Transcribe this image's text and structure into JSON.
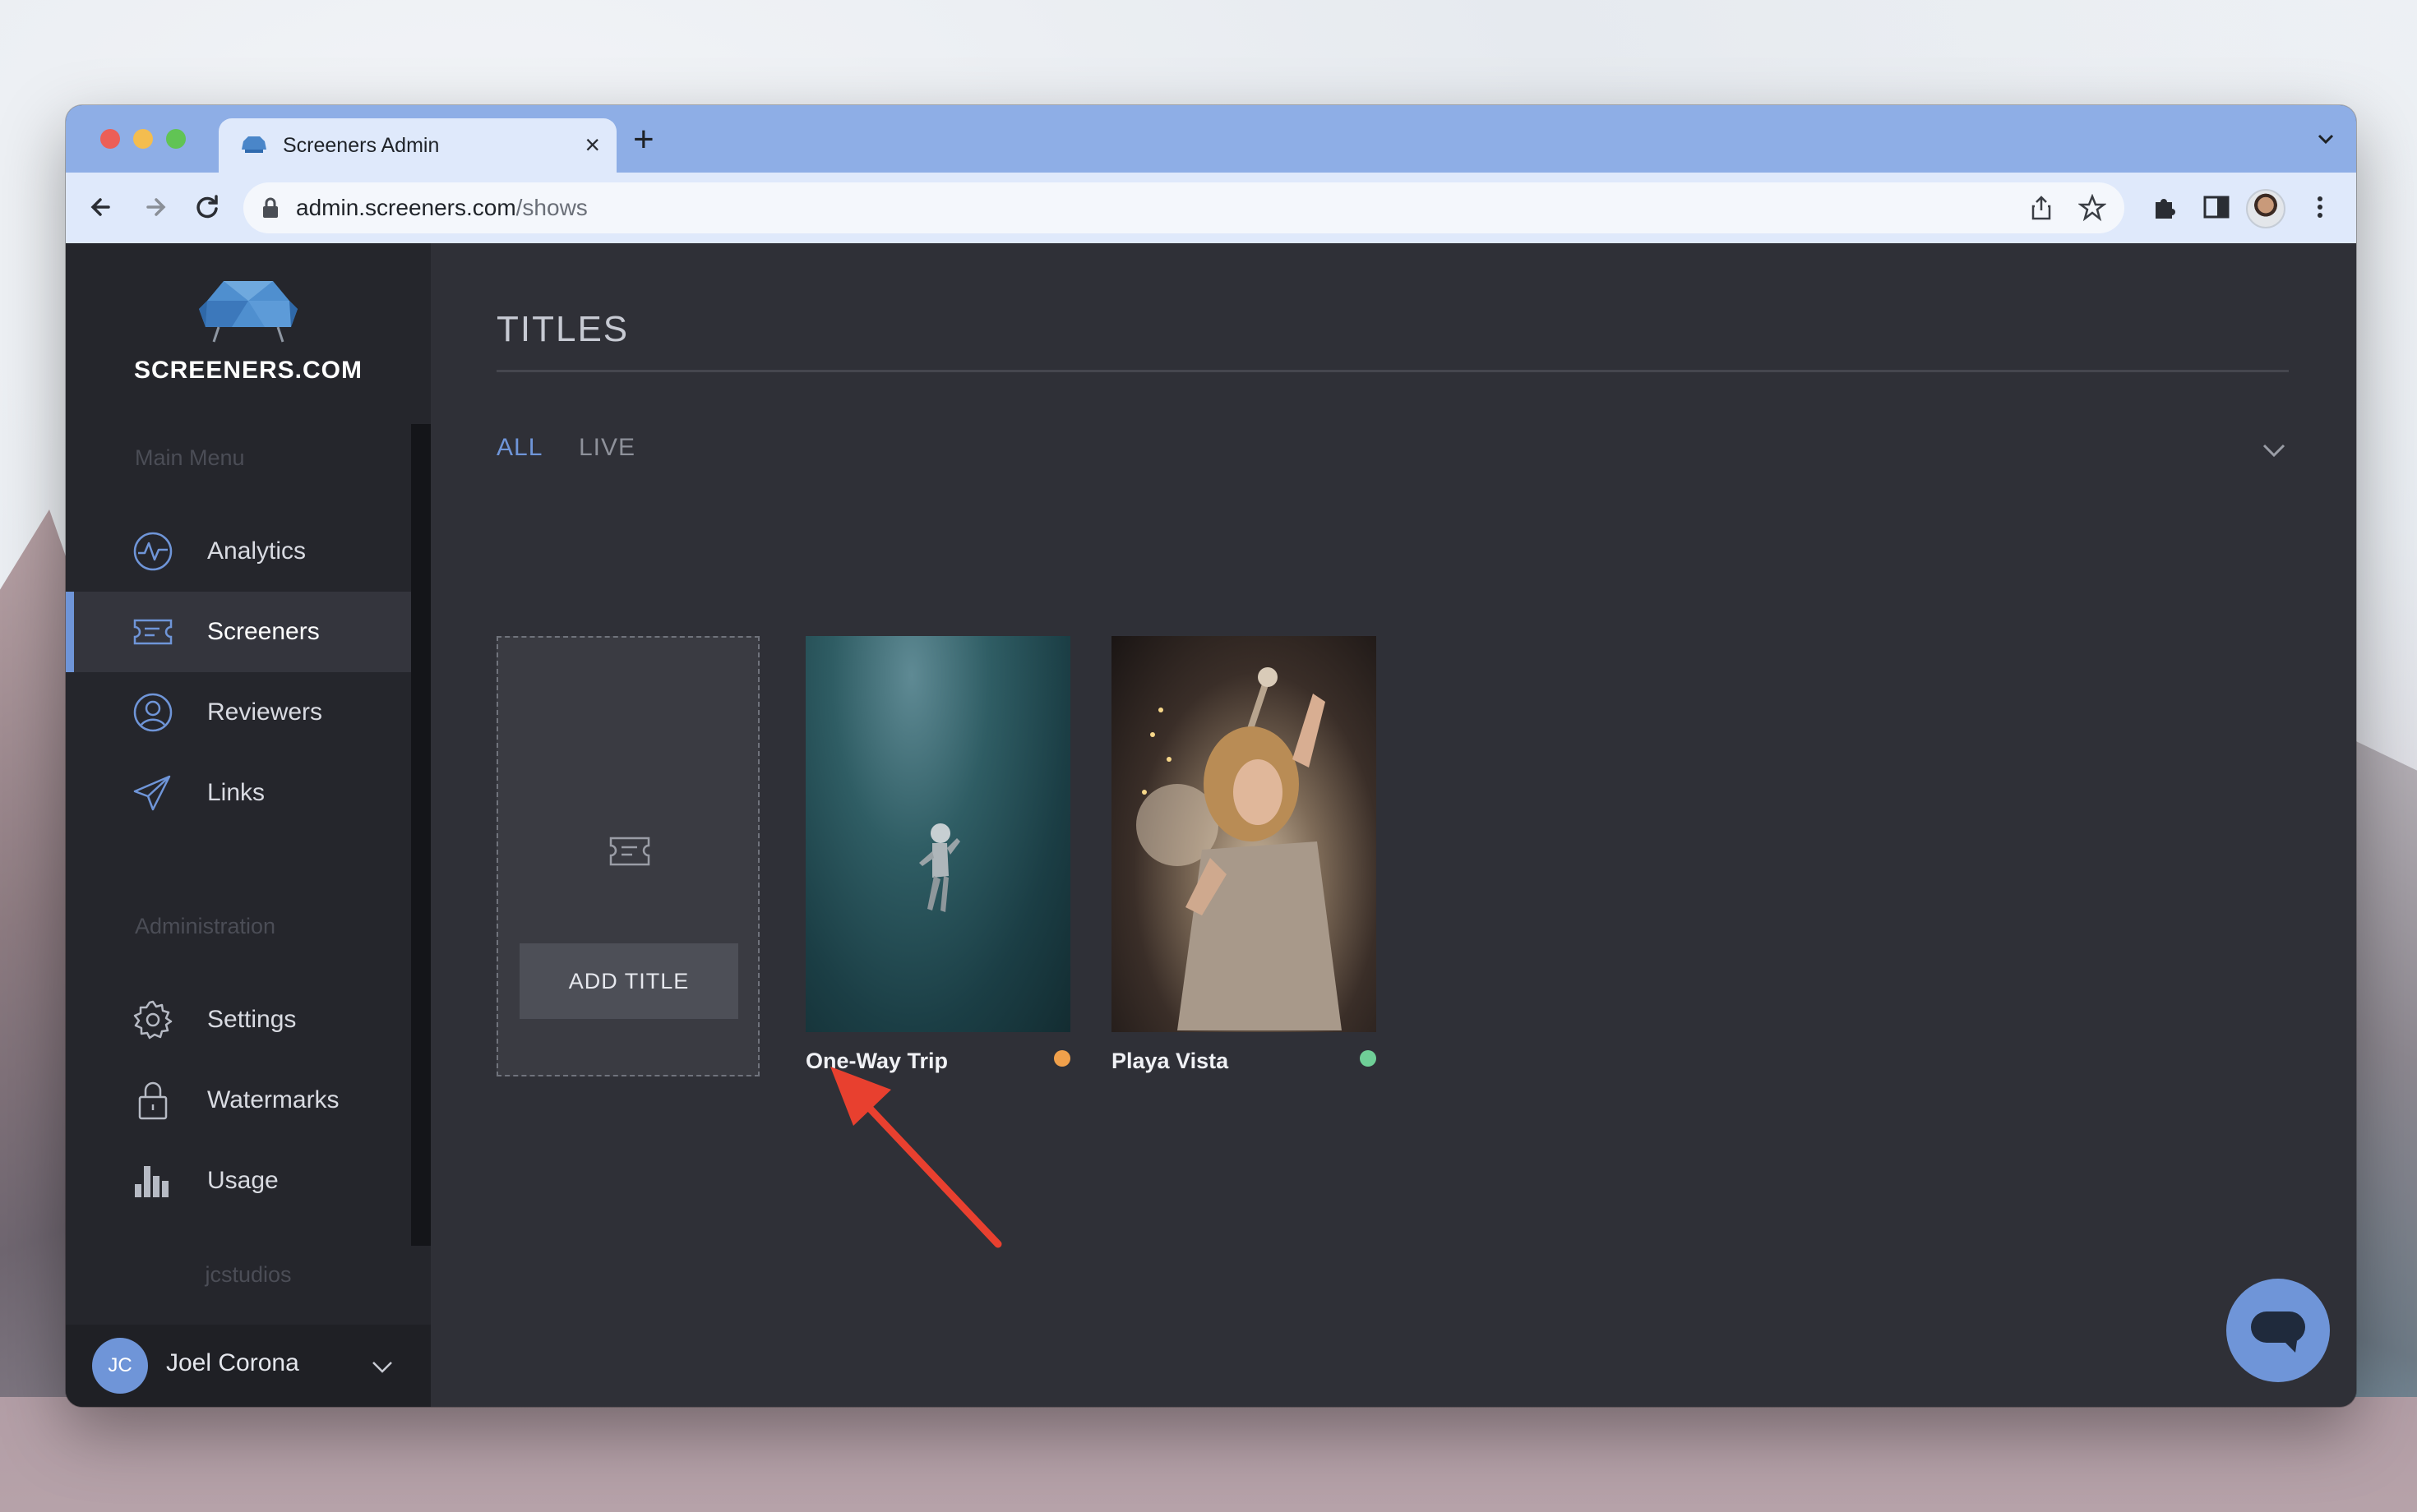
{
  "browser": {
    "tab_title": "Screeners Admin",
    "url_host": "admin.screeners.com",
    "url_path": "/shows"
  },
  "sidebar": {
    "logo_text": "SCREENERS.COM",
    "main_menu_label": "Main Menu",
    "main_items": [
      {
        "label": "Analytics",
        "icon": "pulse-icon"
      },
      {
        "label": "Screeners",
        "icon": "ticket-icon",
        "active": true
      },
      {
        "label": "Reviewers",
        "icon": "user-circle-icon"
      },
      {
        "label": "Links",
        "icon": "paper-plane-icon"
      }
    ],
    "admin_label": "Administration",
    "admin_items": [
      {
        "label": "Settings",
        "icon": "gear-icon"
      },
      {
        "label": "Watermarks",
        "icon": "lock-icon"
      },
      {
        "label": "Usage",
        "icon": "bar-chart-icon"
      }
    ],
    "org_name": "jcstudios",
    "user": {
      "initials": "JC",
      "name": "Joel Corona"
    }
  },
  "main": {
    "title": "TITLES",
    "filters": [
      {
        "label": "ALL",
        "active": true
      },
      {
        "label": "LIVE",
        "active": false
      }
    ],
    "add_title_label": "ADD TITLE",
    "shows": [
      {
        "title": "One-Way Trip",
        "status_color": "#f0a04b"
      },
      {
        "title": "Playa Vista",
        "status_color": "#6fcf97"
      }
    ]
  },
  "colors": {
    "accent": "#6f95d8",
    "annotation_arrow": "#e8402f"
  }
}
